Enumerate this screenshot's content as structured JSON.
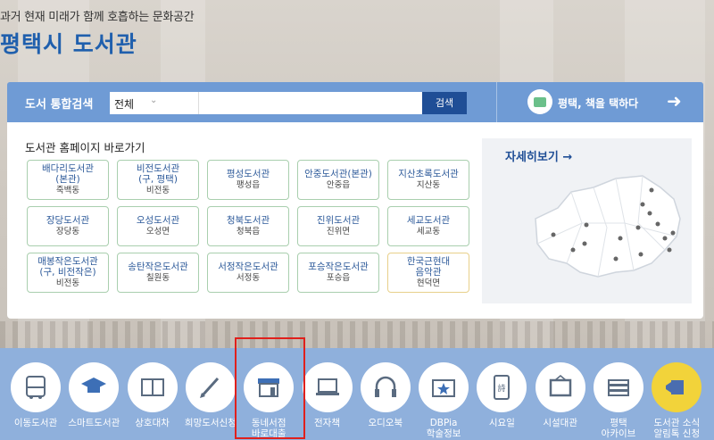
{
  "header": {
    "tagline": "과거 현재 미래가 함께 호흡하는 문화공간",
    "title": "평택시 도서관"
  },
  "search": {
    "label": "도서 통합검색",
    "scope": "전체",
    "placeholder": "",
    "button": "검색"
  },
  "promo": {
    "text": "평택, 책을 택하다"
  },
  "libraries": {
    "title": "도서관 홈페이지 바로가기",
    "items": [
      {
        "name": "배다리도서관\n(본관)",
        "loc": "죽백동"
      },
      {
        "name": "비전도서관\n(구, 평택)",
        "loc": "비전동"
      },
      {
        "name": "평성도서관",
        "loc": "팽성읍"
      },
      {
        "name": "안중도서관(본관)",
        "loc": "안중읍"
      },
      {
        "name": "지산초록도서관",
        "loc": "지산동"
      },
      {
        "name": "장당도서관",
        "loc": "장당동"
      },
      {
        "name": "오성도서관",
        "loc": "오성면"
      },
      {
        "name": "청북도서관",
        "loc": "청북읍"
      },
      {
        "name": "진위도서관",
        "loc": "진위면"
      },
      {
        "name": "세교도서관",
        "loc": "세교동"
      },
      {
        "name": "매봉작은도서관\n(구, 비전작은)",
        "loc": "비전동"
      },
      {
        "name": "송탄작은도서관",
        "loc": "칠원동"
      },
      {
        "name": "서정작은도서관",
        "loc": "서정동"
      },
      {
        "name": "포승작은도서관",
        "loc": "포승읍"
      },
      {
        "name": "한국근현대\n음악관",
        "loc": "현덕면"
      }
    ]
  },
  "map": {
    "title": "자세히보기 →"
  },
  "quick": [
    {
      "label": "이동도서관",
      "icon": "bus-icon"
    },
    {
      "label": "스마트도서관",
      "icon": "graduation-cap-icon"
    },
    {
      "label": "상호대차",
      "icon": "book-open-icon"
    },
    {
      "label": "희망도서신청",
      "icon": "pen-icon"
    },
    {
      "label": "동네서점\n바로대출",
      "icon": "store-icon"
    },
    {
      "label": "전자책",
      "icon": "laptop-icon"
    },
    {
      "label": "오디오북",
      "icon": "headphones-icon"
    },
    {
      "label": "DBPia\n학술정보",
      "icon": "folder-star-icon"
    },
    {
      "label": "시요일",
      "icon": "tablet-poem-icon"
    },
    {
      "label": "시설대관",
      "icon": "frame-icon"
    },
    {
      "label": "평택\n아카이브",
      "icon": "book-stack-icon"
    },
    {
      "label": "도서관 소식\n알림톡 신청",
      "icon": "notice-icon"
    }
  ],
  "colors": {
    "accent": "#1f5fad",
    "bar": "#6f9bd5",
    "bottom": "#8fb0dc",
    "highlight": "#e0201c"
  }
}
